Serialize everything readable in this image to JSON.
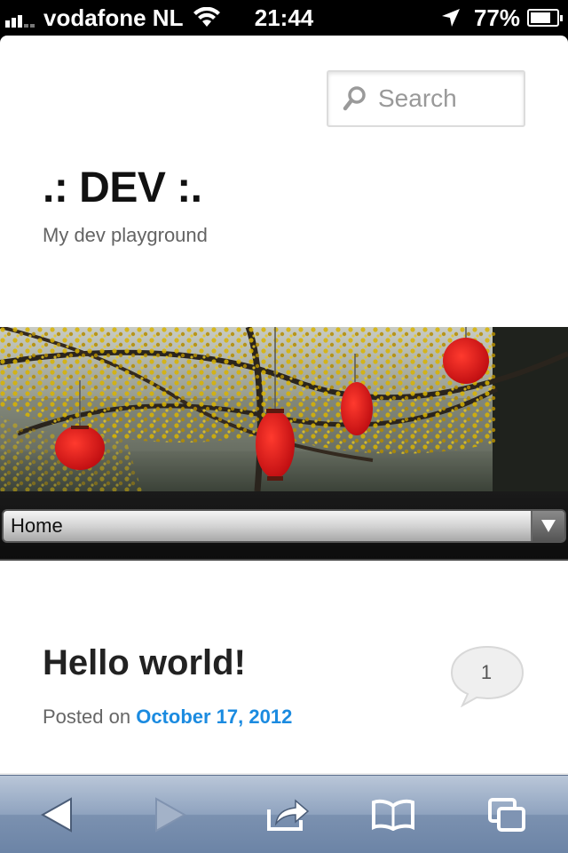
{
  "status_bar": {
    "carrier": "vodafone NL",
    "time": "21:44",
    "battery": "77%",
    "battery_level": 0.77
  },
  "search": {
    "placeholder": "Search"
  },
  "site": {
    "title": ".: DEV :.",
    "description": "My dev playground"
  },
  "nav": {
    "selected": "Home"
  },
  "post": {
    "title": "Hello world!",
    "comment_count": "1",
    "posted_on_label": "Posted on",
    "date": "October 17, 2012"
  },
  "toolbar": {
    "icons": [
      "back-icon",
      "forward-icon",
      "share-icon",
      "bookmarks-icon",
      "tabs-icon"
    ]
  },
  "colors": {
    "link": "#1b8be0",
    "title": "#111111",
    "lantern": "#e0161a",
    "blossom": "#d6b400"
  }
}
